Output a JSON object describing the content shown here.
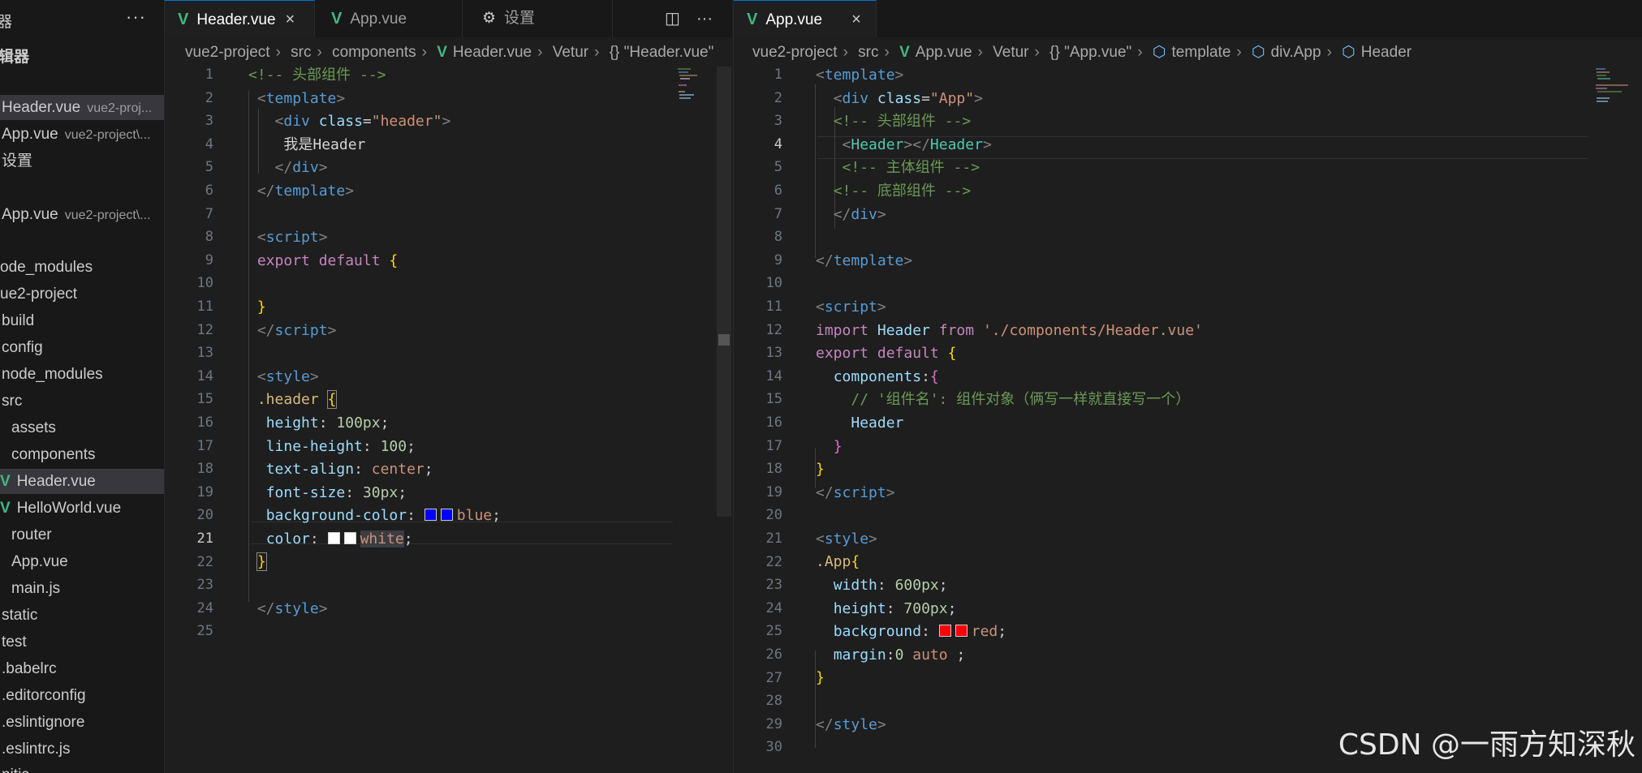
{
  "sidebar": {
    "title": "器",
    "section": "辑器",
    "open_editors": [
      {
        "label": "Header.vue",
        "sub": "vue2-proj..."
      },
      {
        "label": "App.vue",
        "sub": "vue2-project\\..."
      },
      {
        "label": "设置",
        "sub": ""
      },
      {
        "label": "App.vue",
        "sub": "vue2-project\\..."
      }
    ],
    "tree": [
      "ode_modules",
      "ue2-project",
      "build",
      "config",
      "node_modules",
      "src",
      "assets",
      "components",
      "Header.vue",
      "HelloWorld.vue",
      "router",
      "App.vue",
      "main.js",
      "static",
      "test",
      ".babelrc",
      ".editorconfig",
      ".eslintignore",
      ".eslintrc.js",
      "nitia"
    ]
  },
  "left_group": {
    "tabs": [
      {
        "label": "Header.vue",
        "close": "×"
      },
      {
        "label": "App.vue"
      },
      {
        "label": "设置"
      }
    ],
    "breadcrumb": [
      "vue2-project",
      "src",
      "components",
      "Header.vue",
      "Vetur",
      "{} \"Header.vue\""
    ],
    "current_line": "21"
  },
  "right_group": {
    "tabs": [
      {
        "label": "App.vue",
        "close": "×"
      }
    ],
    "breadcrumb": [
      "vue2-project",
      "src",
      "App.vue",
      "Vetur",
      "{} \"App.vue\"",
      "template",
      "div.App",
      "Header"
    ],
    "current_line": "4"
  },
  "watermark": "CSDN @一雨方知深秋",
  "colors": {
    "vue_icon": "#41b883",
    "active_tab_border": "#0078d4",
    "swatch_blue": "#0000ff",
    "swatch_white": "#ffffff",
    "swatch_red": "#ff0000"
  }
}
